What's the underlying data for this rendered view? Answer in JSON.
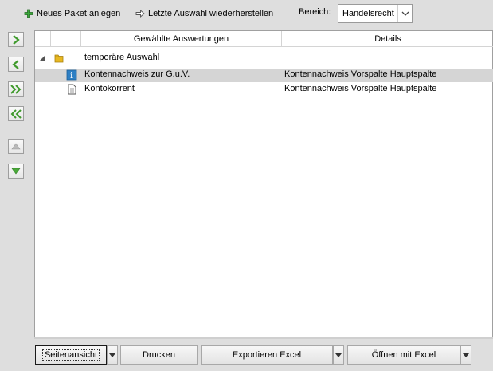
{
  "toolbar": {
    "new_package_label": "Neues Paket anlegen",
    "restore_label": "Letzte Auswahl wiederherstellen",
    "scope_label": "Bereich:",
    "scope_value": "Handelsrecht"
  },
  "side_buttons": [
    "chevron-right-icon",
    "chevron-left-icon",
    "double-chevron-right-icon",
    "double-chevron-left-icon",
    "triangle-up-icon",
    "triangle-down-icon"
  ],
  "grid": {
    "columns": [
      "Gewählte Auswertungen",
      "Details"
    ],
    "group": {
      "label": "temporäre Auswahl",
      "expand_glyph": "◢"
    },
    "rows": [
      {
        "name": "Kontennachweis zur G.u.V.",
        "details": "Kontennachweis Vorspalte Hauptspalte",
        "icon": "info-icon",
        "selected": true
      },
      {
        "name": "Kontokorrent",
        "details": "Kontennachweis Vorspalte Hauptspalte",
        "icon": "document-icon",
        "selected": false
      }
    ]
  },
  "bottom": {
    "page_view_label": "Seitenansicht",
    "print_label": "Drucken",
    "export_excel_label": "Exportieren Excel",
    "open_excel_label": "Öffnen mit Excel"
  },
  "colors": {
    "background": "#dedede",
    "selection": "#d5d5d5",
    "plus_green": "#3aa63a",
    "side_green": "#3f9a2c",
    "info_blue": "#2d7fc4",
    "folder_yellow": "#e8b821"
  }
}
